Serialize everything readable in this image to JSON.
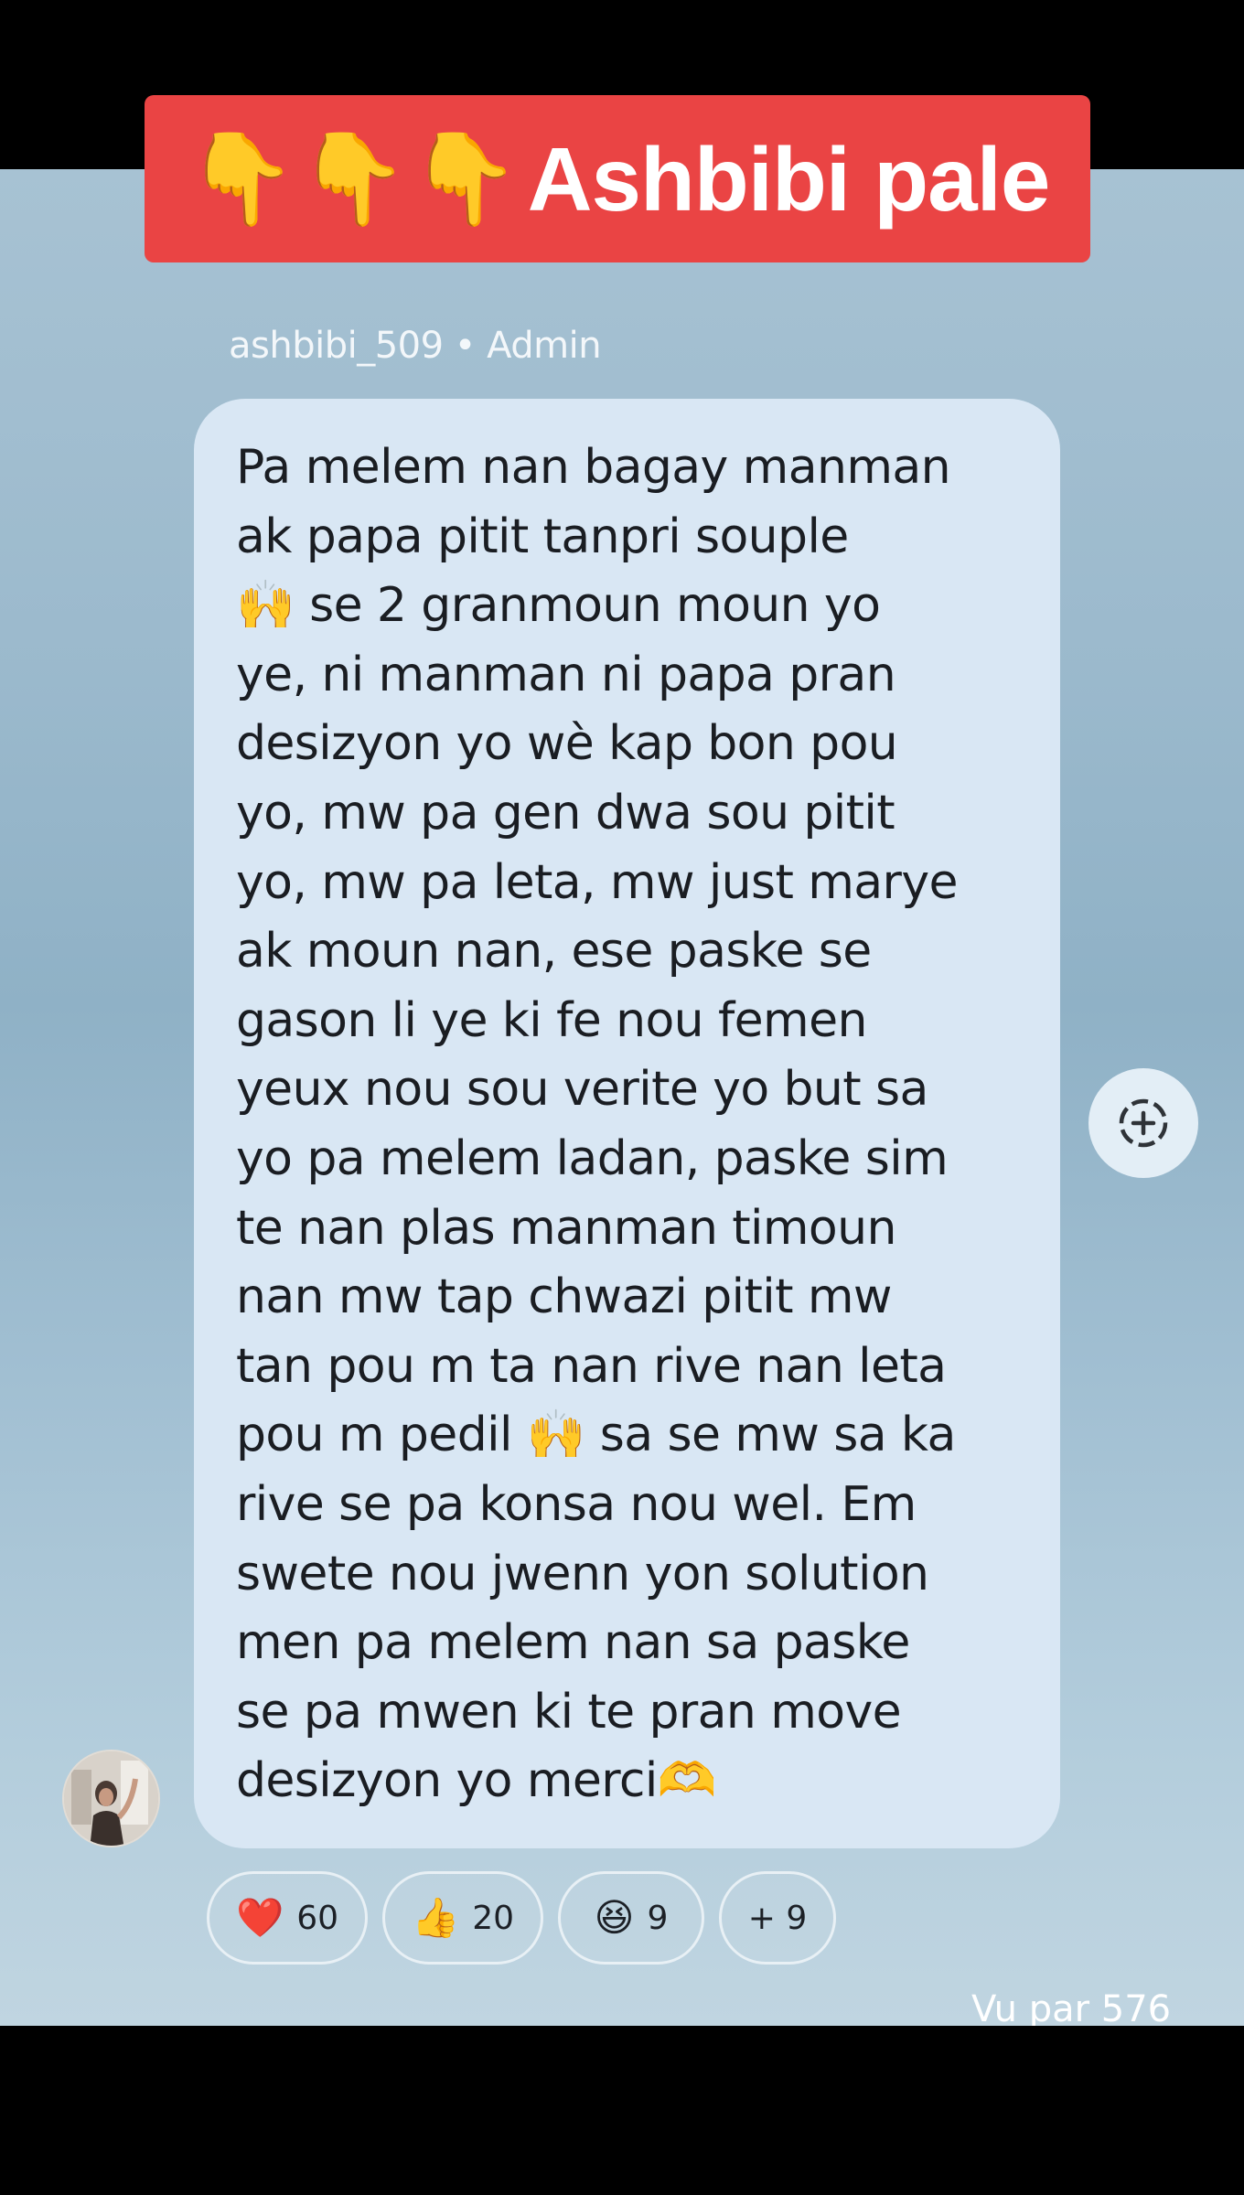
{
  "banner": {
    "emoji": "👇👇👇",
    "title": "Ashbibi pale"
  },
  "message": {
    "sender": "ashbibi_509 • Admin",
    "text": "Pa melem nan bagay manman\nak papa pitit tanpri souple\n🙌 se 2 granmoun moun yo\nye, ni manman ni papa pran\ndesizyon yo wè kap bon pou\nyo, mw pa gen dwa sou pitit\nyo, mw pa leta, mw just marye\nak moun nan,  ese paske se\ngason li ye ki fe nou femen\nyeux nou sou verite yo but sa\nyo pa melem ladan, paske sim\nte nan plas manman timoun\nnan mw tap chwazi pitit mw\ntan pou m ta nan rive nan leta\npou m pedil 🙌 sa se mw sa ka\nrive se pa konsa nou wel. Em\nswete nou jwenn yon solution\nmen pa melem nan sa paske\nse pa mwen ki te pran move\ndesizyon yo merci🫶"
  },
  "reactions": [
    {
      "emoji": "❤️",
      "count": "60"
    },
    {
      "emoji": "👍",
      "count": "20"
    },
    {
      "emoji": "😆",
      "count": "9"
    }
  ],
  "more_reactions": "+ 9",
  "seen_by": "Vu par 576",
  "icons": {
    "add_reaction": "add-reaction-icon",
    "avatar": "user-avatar"
  }
}
